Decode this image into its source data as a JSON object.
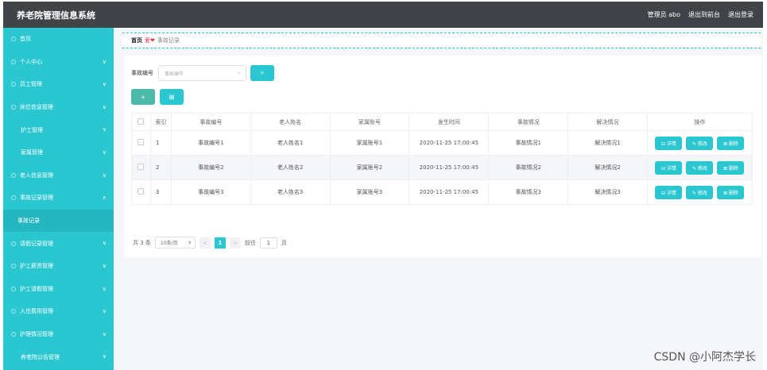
{
  "header": {
    "title": "养老院管理信息系统",
    "links": [
      "管理员 abo",
      "退出到前台",
      "退出登录"
    ]
  },
  "sidebar": {
    "items": [
      {
        "label": "首页",
        "chevron": "",
        "type": "top"
      },
      {
        "label": "个人中心",
        "chevron": "∨",
        "type": "top"
      },
      {
        "label": "员工管理",
        "chevron": "∨",
        "type": "top"
      },
      {
        "label": "床位信息管理",
        "chevron": "∨",
        "type": "top"
      },
      {
        "label": "护工管理",
        "chevron": "∨",
        "type": "sub"
      },
      {
        "label": "家属管理",
        "chevron": "∨",
        "type": "sub"
      },
      {
        "label": "老人信息管理",
        "chevron": "∨",
        "type": "top"
      },
      {
        "label": "事故记录管理",
        "chevron": "∧",
        "type": "top"
      },
      {
        "label": "事故记录",
        "chevron": "",
        "type": "active-sub"
      },
      {
        "label": "请假记录管理",
        "chevron": "∨",
        "type": "top"
      },
      {
        "label": "护工薪资管理",
        "chevron": "∨",
        "type": "top"
      },
      {
        "label": "护工请假管理",
        "chevron": "∨",
        "type": "top"
      },
      {
        "label": "入住费用管理",
        "chevron": "∨",
        "type": "top"
      },
      {
        "label": "护理情况管理",
        "chevron": "∨",
        "type": "top"
      },
      {
        "label": "养老院公告管理",
        "chevron": "∨",
        "type": "sub"
      }
    ]
  },
  "breadcrumb": {
    "home": "首页",
    "heart": "爱❤",
    "current": "事故记录"
  },
  "search": {
    "label": "事故编号",
    "placeholder": "事故编号",
    "search_icon": "search-icon"
  },
  "actions": {
    "add_icon": "plus-icon",
    "delete_icon": "trash-icon"
  },
  "table": {
    "headers": [
      "索引",
      "事故编号",
      "老人姓名",
      "家属账号",
      "发生时间",
      "事故情况",
      "解决情况",
      "操作"
    ],
    "rows": [
      {
        "index": "1",
        "code": "事故编号1",
        "name": "老人姓名1",
        "account": "家属账号1",
        "time": "2020-11-25 17:00:45",
        "situation": "事故情况1",
        "resolution": "解决情况1"
      },
      {
        "index": "2",
        "code": "事故编号2",
        "name": "老人姓名2",
        "account": "家属账号2",
        "time": "2020-11-25 17:00:45",
        "situation": "事故情况2",
        "resolution": "解决情况2"
      },
      {
        "index": "3",
        "code": "事故编号3",
        "name": "老人姓名3",
        "account": "家属账号3",
        "time": "2020-11-25 17:00:45",
        "situation": "事故情况3",
        "resolution": "解决情况3"
      }
    ],
    "row_buttons": {
      "detail": "⊟ 详情",
      "edit": "✎ 修改",
      "delete": "⊠ 删除"
    }
  },
  "pagination": {
    "total": "共 3 条",
    "page_size": "10条/页",
    "prev": "<",
    "current_page": "1",
    "next": ">",
    "goto_label": "前往",
    "goto_value": "1",
    "page_suffix": "页"
  },
  "watermark": "CSDN @小阿杰学长",
  "colors": {
    "accent": "#2ac7d1",
    "header_bg": "#404448"
  }
}
